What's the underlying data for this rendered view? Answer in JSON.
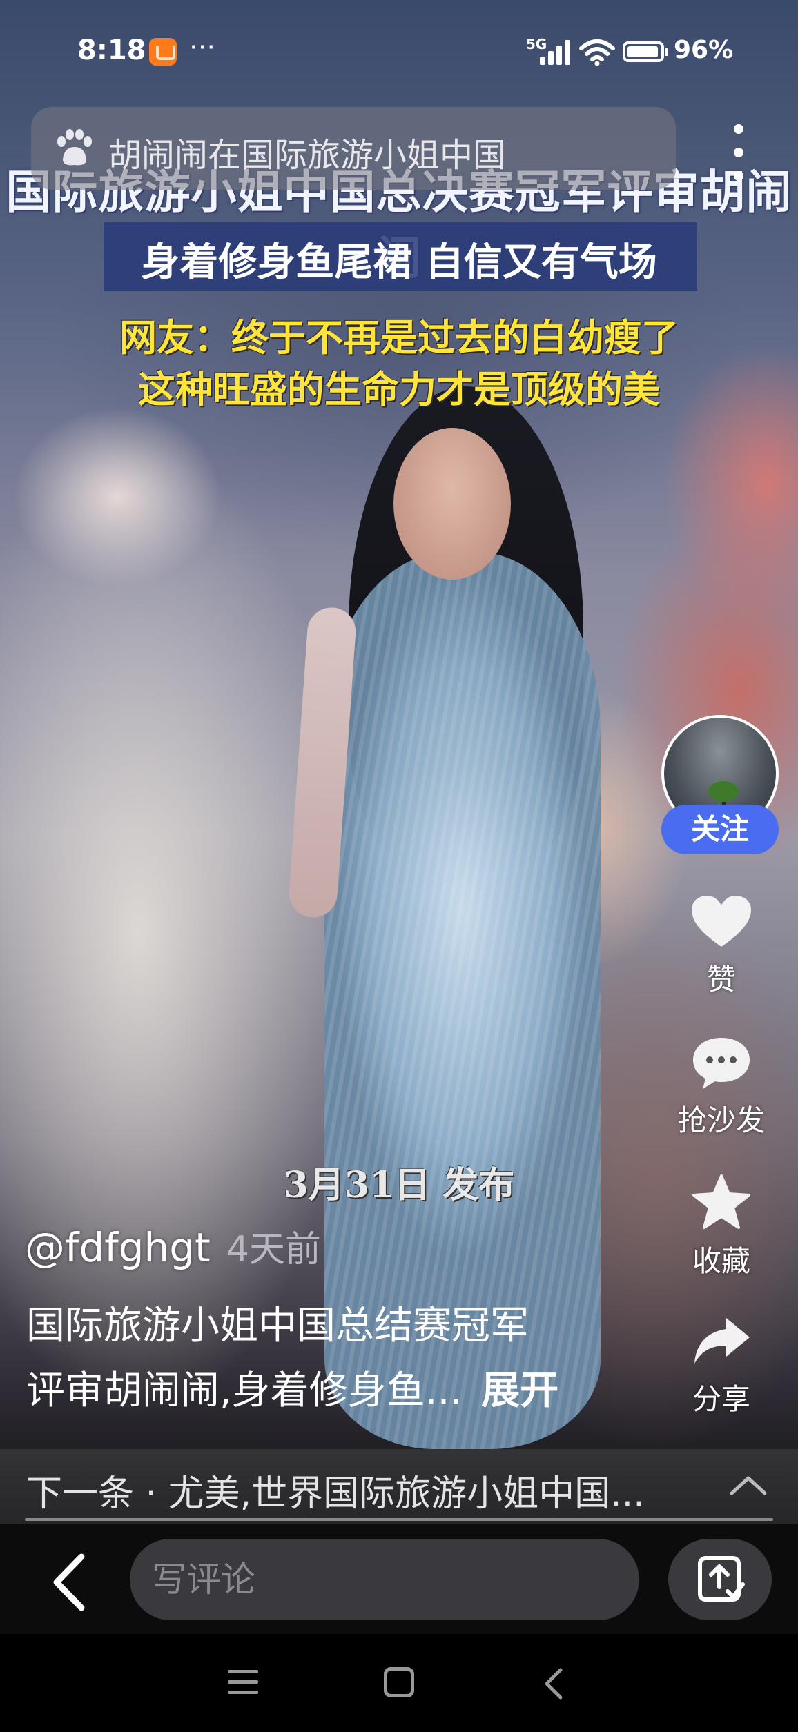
{
  "status_bar": {
    "time": "8:18",
    "app_icon": "shopping-bag-icon",
    "more": "···",
    "network": "5G",
    "battery": "96%"
  },
  "search_bar": {
    "text": "胡闹闹在国际旅游小姐中国",
    "icon": "baidu-paw-icon"
  },
  "video": {
    "caption_title": "国际旅游小姐中国总决赛冠军评审胡闹闹",
    "caption_subtitle": "身着修身鱼尾裙 自信又有气场",
    "caption_comment_1": "网友：终于不再是过去的白幼瘦了",
    "caption_comment_2": "这种旺盛的生命力才是顶级的美",
    "publish_date": "3月31日 发布"
  },
  "right_rail": {
    "follow_label": "关注",
    "like_label": "赞",
    "comment_label": "抢沙发",
    "favorite_label": "收藏",
    "share_label": "分享"
  },
  "post": {
    "author": "@fdfghgt",
    "time_ago": "4天前",
    "description_line1": "国际旅游小姐中国总结赛冠军",
    "description_line2": "评审胡闹闹,身着修身鱼...",
    "expand_label": "展开"
  },
  "next_bar": {
    "text": "下一条 · 尤美,世界国际旅游小姐中国..."
  },
  "comment_bar": {
    "placeholder": "写评论"
  },
  "colors": {
    "follow_button": "#4a6cf0",
    "caption_yellow": "#ffe43a",
    "caption_box": "#283a78",
    "status_app_icon": "#ff7a1a"
  }
}
